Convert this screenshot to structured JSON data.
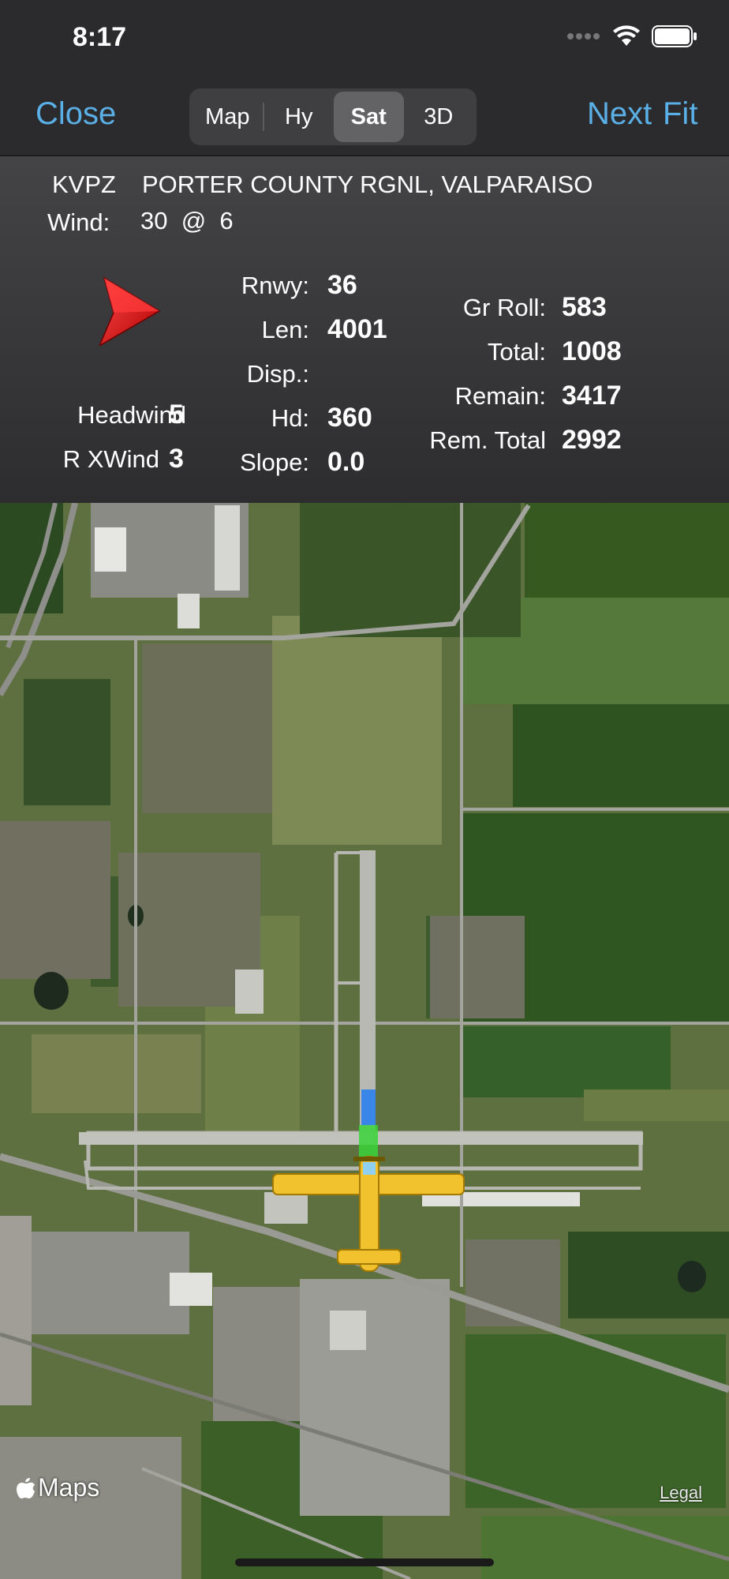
{
  "status": {
    "time": "8:17"
  },
  "nav": {
    "close_label": "Close",
    "segments": [
      "Map",
      "Hy",
      "Sat",
      "3D"
    ],
    "selected_segment": "Sat",
    "next_label": "Next",
    "fit_label": "Fit",
    "accent_color": "#5ab0e6"
  },
  "airport": {
    "code": "KVPZ",
    "name": "PORTER COUNTY RGNL, VALPARAISO",
    "wind_label": "Wind:",
    "wind_value": "30  @  6",
    "wind_arrow_color": "#e31515"
  },
  "runway": {
    "rnwy_label": "Rnwy:",
    "rnwy_value": "36",
    "len_label": "Len:",
    "len_value": "4001",
    "disp_label": "Disp.:",
    "disp_value": "",
    "hd_label": "Hd:",
    "hd_value": "360",
    "slope_label": "Slope:",
    "slope_value": "0.0"
  },
  "wind_components": {
    "headwind_label": "Headwind",
    "headwind_value": "5",
    "xwind_label": "R XWind",
    "xwind_value": "3"
  },
  "performance": {
    "grroll_label": "Gr Roll:",
    "grroll_value": "583",
    "total_label": "Total:",
    "total_value": "1008",
    "remain_label": "Remain:",
    "remain_value": "3417",
    "remtotal_label": "Rem. Total",
    "remtotal_value": "2992"
  },
  "map": {
    "attribution": "Maps",
    "legal_label": "Legal",
    "aircraft_color": "#f2c12e",
    "ground_roll_color": "#3a86e8",
    "total_distance_color": "#3ad33a"
  }
}
